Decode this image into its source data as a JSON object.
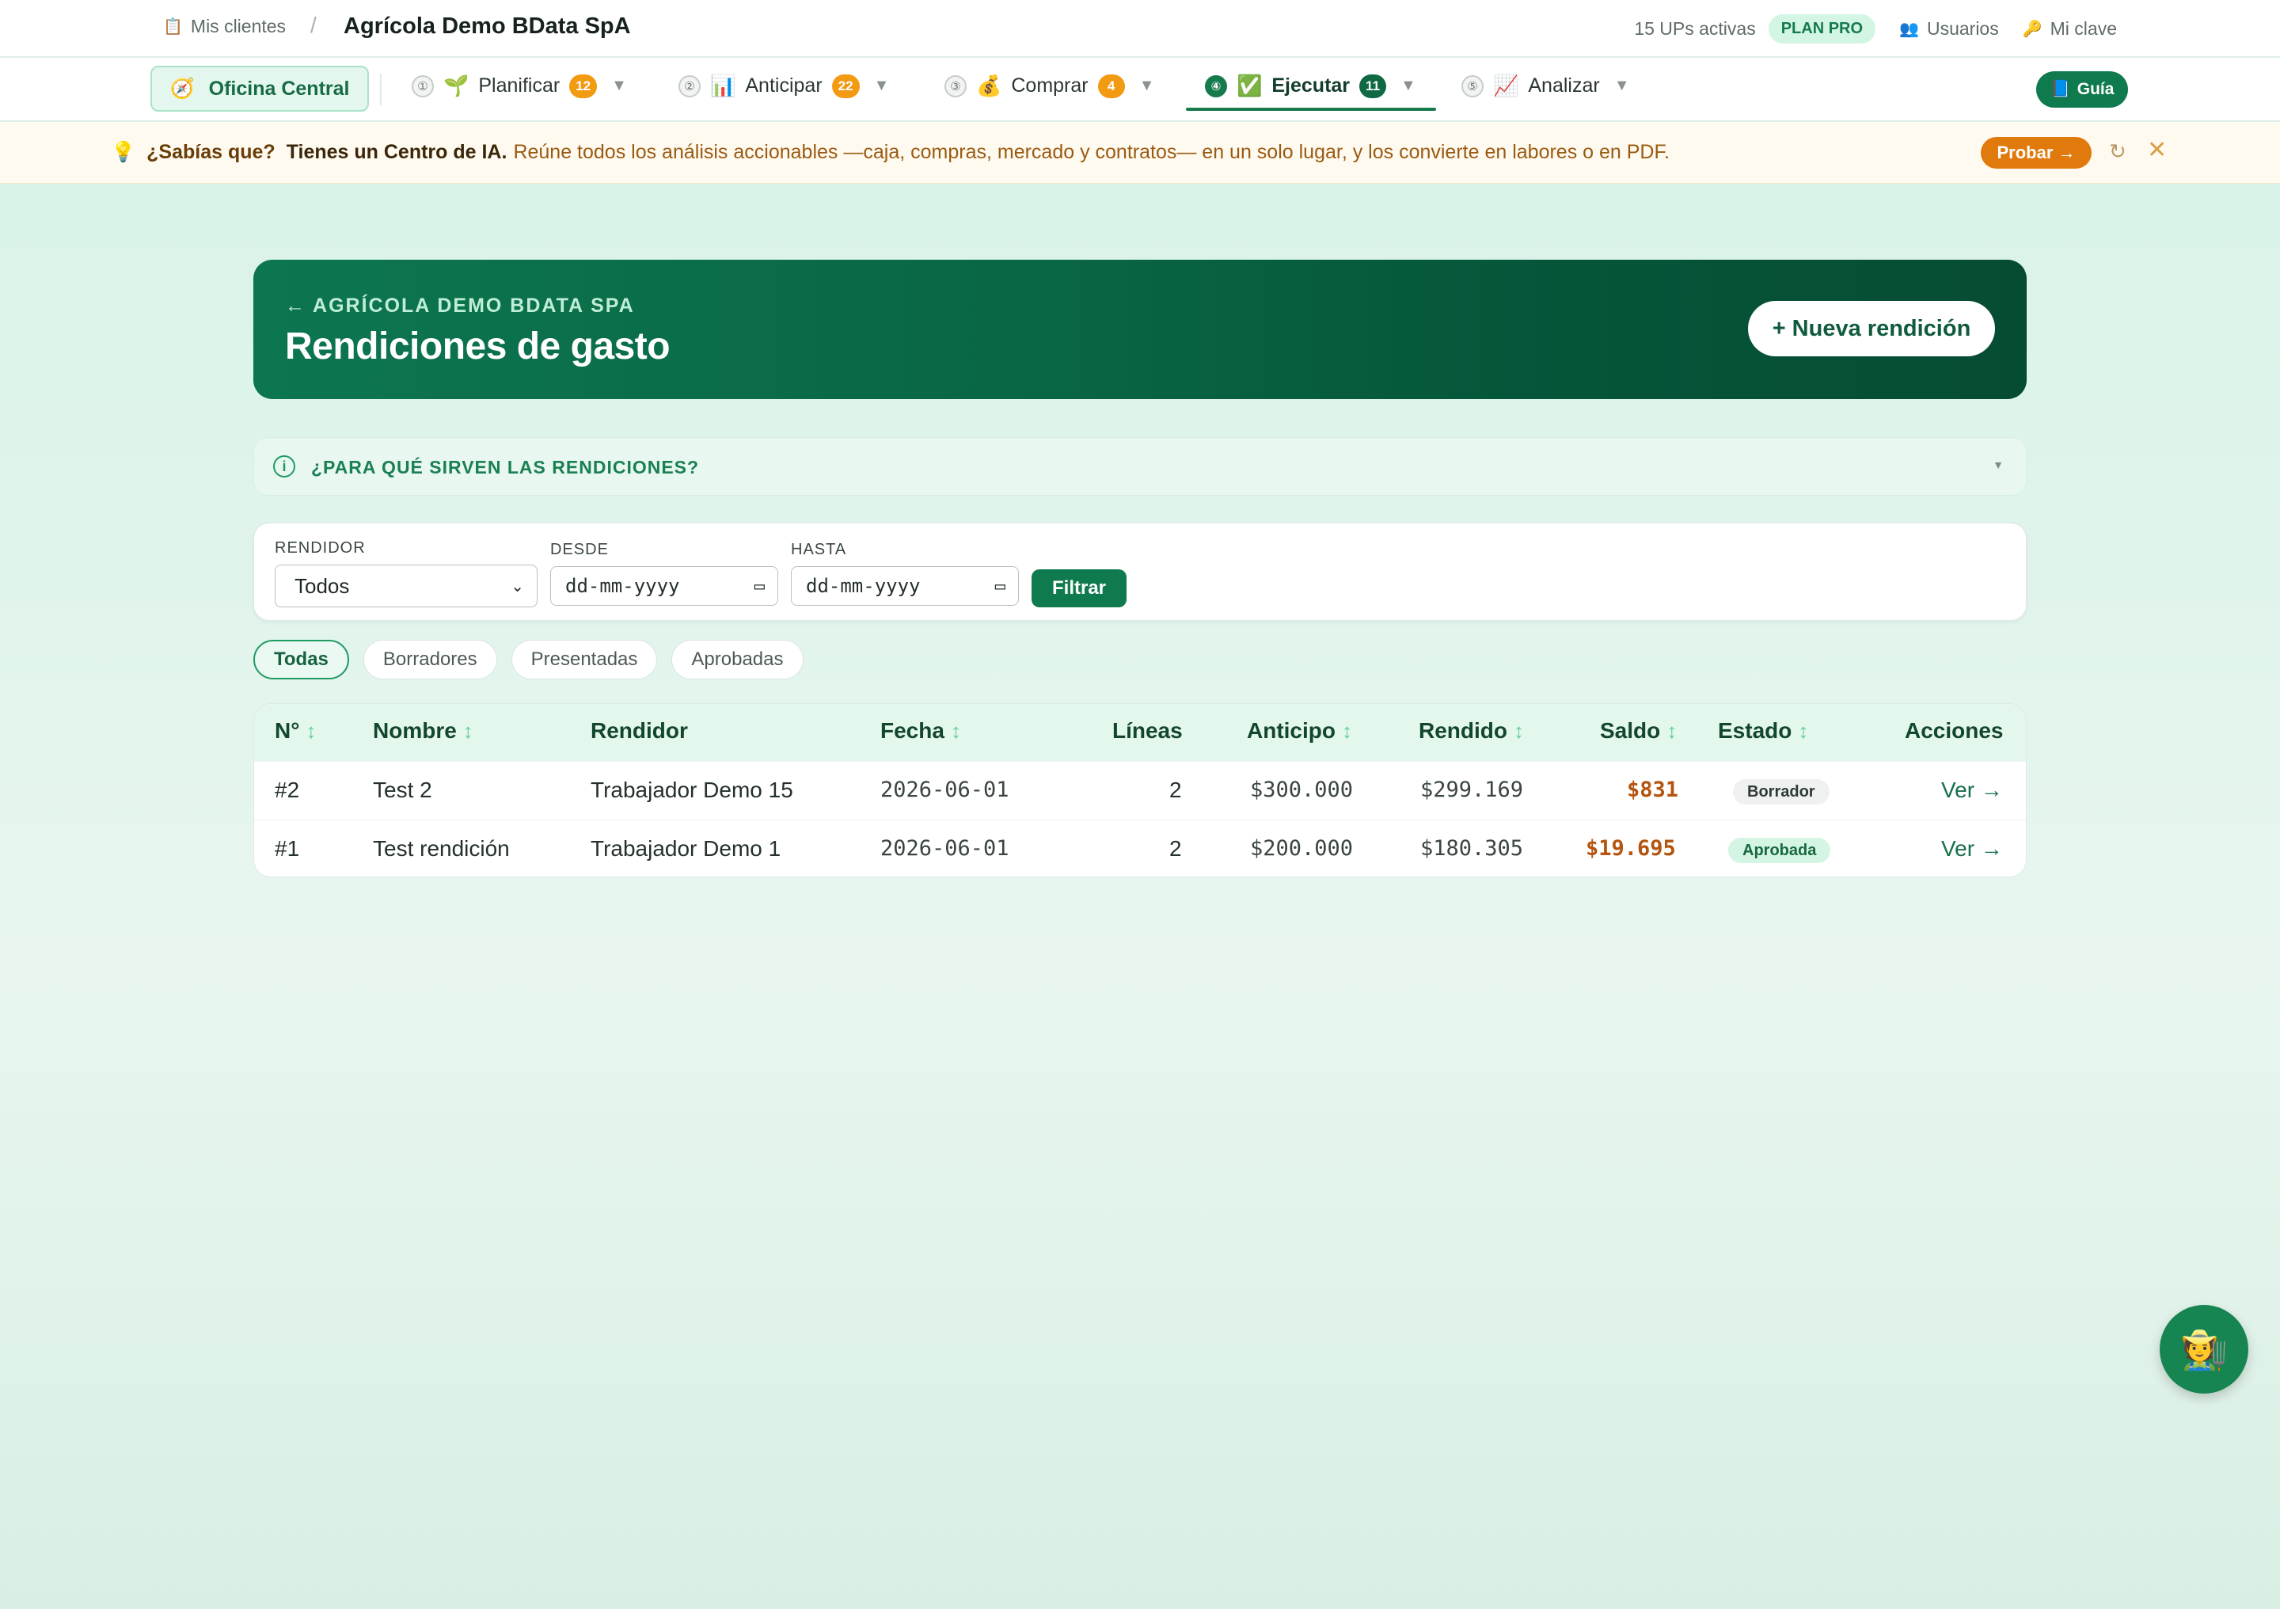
{
  "topbar": {
    "clients_icon": "clipboard-icon",
    "clients_label": "Mis clientes",
    "separator": "/",
    "company": "Agrícola Demo BData SpA",
    "ups": "15 UPs activas",
    "plan": "PLAN PRO",
    "users_label": "Usuarios",
    "password_label": "Mi clave"
  },
  "nav": {
    "office": "Oficina Central",
    "items": [
      {
        "step": "①",
        "emoji": "🌱",
        "label": "Planificar",
        "count": "12"
      },
      {
        "step": "②",
        "emoji": "📊",
        "label": "Anticipar",
        "count": "22"
      },
      {
        "step": "③",
        "emoji": "💰",
        "label": "Comprar",
        "count": "4"
      },
      {
        "step": "④",
        "emoji": "✅",
        "label": "Ejecutar",
        "count": "11"
      },
      {
        "step": "⑤",
        "emoji": "📈",
        "label": "Analizar",
        "count": ""
      }
    ],
    "guide": "Guía"
  },
  "tip": {
    "question": "¿Sabías que?",
    "strong": "Tienes un Centro de IA.",
    "text": "Reúne todos los análisis accionables —caja, compras, mercado y contratos— en un solo lugar, y los convierte en labores o en PDF.",
    "try_label": "Probar →"
  },
  "hero": {
    "back": "← AGRÍCOLA DEMO BDATA SPA",
    "title": "Rendiciones de gasto",
    "new_button": "+ Nueva rendición"
  },
  "faq": {
    "label": "¿PARA QUÉ SIRVEN LAS RENDICIONES?"
  },
  "filters": {
    "rendidor_label": "RENDIDOR",
    "rendidor_value": "Todos",
    "desde_label": "DESDE",
    "desde_placeholder": "dd-mm-yyyy",
    "hasta_label": "HASTA",
    "hasta_placeholder": "dd-mm-yyyy",
    "button": "Filtrar"
  },
  "tabs": [
    "Todas",
    "Borradores",
    "Presentadas",
    "Aprobadas"
  ],
  "table": {
    "headers": {
      "num": "N°",
      "name": "Nombre",
      "rendidor": "Rendidor",
      "fecha": "Fecha",
      "lineas": "Líneas",
      "anticipo": "Anticipo",
      "rendido": "Rendido",
      "saldo": "Saldo",
      "estado": "Estado",
      "acciones": "Acciones"
    },
    "rows": [
      {
        "num": "#2",
        "name": "Test 2",
        "rendidor": "Trabajador Demo 15",
        "fecha": "2026-06-01",
        "lineas": "2",
        "anticipo": "$300.000",
        "rendido": "$299.169",
        "saldo": "$831",
        "estado": "Borrador",
        "accion": "Ver →"
      },
      {
        "num": "#1",
        "name": "Test rendición",
        "rendidor": "Trabajador Demo 1",
        "fecha": "2026-06-01",
        "lineas": "2",
        "anticipo": "$200.000",
        "rendido": "$180.305",
        "saldo": "$19.695",
        "estado": "Aprobada",
        "accion": "Ver →"
      }
    ]
  },
  "colors": {
    "brand_green": "#0f7a4d",
    "accent_orange": "#f29a11",
    "saldo_color": "#b4540e"
  }
}
